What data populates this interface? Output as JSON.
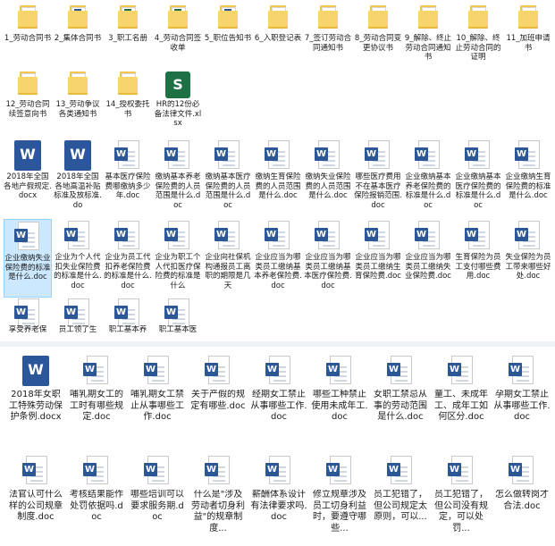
{
  "row1": [
    {
      "label": "1_劳动合同书",
      "icon": "folder-icon"
    },
    {
      "label": "2_集体合同书",
      "icon": "folder-word-icon"
    },
    {
      "label": "3_职工名册",
      "icon": "folder-excel-icon"
    },
    {
      "label": "4_劳动合同签收单",
      "icon": "folder-excel-icon"
    },
    {
      "label": "5_职位告知书",
      "icon": "folder-word-icon"
    },
    {
      "label": "6_入职登记表",
      "icon": "folder-icon"
    },
    {
      "label": "7_签订劳动合同通知书",
      "icon": "folder-icon"
    },
    {
      "label": "8_劳动合同变更协议书",
      "icon": "folder-icon"
    },
    {
      "label": "9_解除、终止劳动合同通知书",
      "icon": "folder-icon"
    },
    {
      "label": "10_解除、终止劳动合同的证明",
      "icon": "folder-icon"
    },
    {
      "label": "11_加班申请书",
      "icon": "folder-icon"
    }
  ],
  "row2": [
    {
      "label": "12_劳动合同续签意向书",
      "icon": "folder-icon"
    },
    {
      "label": "13_劳动争议各类通知书",
      "icon": "folder-icon"
    },
    {
      "label": "14_授权委托书",
      "icon": "folder-icon"
    },
    {
      "label": "HR的12份必备法律文件.xlsx",
      "icon": "excel-file-icon"
    }
  ],
  "row3": [
    "2018年全国各地产假规定.docx",
    "2018年全国各地高温补贴标准及放标准.do",
    "基本医疗保险费哪缴纳多少年.doc",
    "缴纳基本养老保险费的人员范围是什么.doc",
    "缴纳基本医疗保险费的人员范围是什么.doc",
    "缴纳生育保险费的人员范围是什么.doc",
    "缴纳失业保险费的人员范围是什么.doc",
    "哪些医疗费用不在基本医疗保险报销范围.doc",
    "企业缴纳基本养老保险费的标准是什么.doc",
    "企业缴纳基本医疗保险费的标准是什么.doc",
    "企业缴纳生育保险费的标准是什么.doc"
  ],
  "row4": [
    "企业缴纳失业保险费的标准是什么.doc",
    "企业为个人代扣失业保险费的标准是什么.doc",
    "企业为员工代扣养老保险费的标准是什么.doc",
    "企业为职工个人代扣医疗保险费的标准是什么",
    "企业向社保机构通报员工离职的期限是几天",
    "企业应当为哪类员工缴纳基本养老保险费.doc",
    "企业应当为哪类员工缴纳基本医疗保险费.doc",
    "企业应当为哪类员工缴纳生育保险费.doc",
    "企业应当为哪类员工缴纳失业保险费.doc",
    "生育保险为员工支付哪些费用.doc",
    "失业保险为员工带来哪些好处.doc"
  ],
  "row5": [
    "享受养老保",
    "员工领了生",
    "职工基本养",
    "职工基本医"
  ],
  "row6": [
    "2018年女职工特殊劳动保护条例.docx",
    "哺乳期女工的工时有哪些规定.doc",
    "哺乳期女工禁止从事哪些工作.doc",
    "关于产假的规定有哪些.doc",
    "经期女工禁止从事哪些工作.doc",
    "哪些工种禁止使用未成年工.doc",
    "女职工禁忌从事的劳动范围是什么.doc",
    "童工、未成年工、成年工如何区分.doc",
    "孕期女工禁止从事哪些工作.doc"
  ],
  "row7": [
    "法官认可什么样的公司规章制度.doc",
    "考核结果能作处罚依据吗.doc",
    "哪些培训可以要求服务期.doc",
    "什么是\"涉及劳动者切身利益\"的规章制度...",
    "薪酬体系设计有法律要求吗.doc",
    "修立规章涉及员工切身利益时，要遵守哪些...",
    "员工犯错了，但公司规定太原则，可以...",
    "员工犯错了，但公司没有规定，可以处罚...",
    "怎么做转岗才合法.doc"
  ],
  "selected_item": "企业缴纳失业保险费的标准是什么.doc",
  "colors": {
    "folder": "#f7d46c",
    "word": "#2b579a",
    "excel": "#1e7145",
    "selection": "#cce8ff"
  }
}
